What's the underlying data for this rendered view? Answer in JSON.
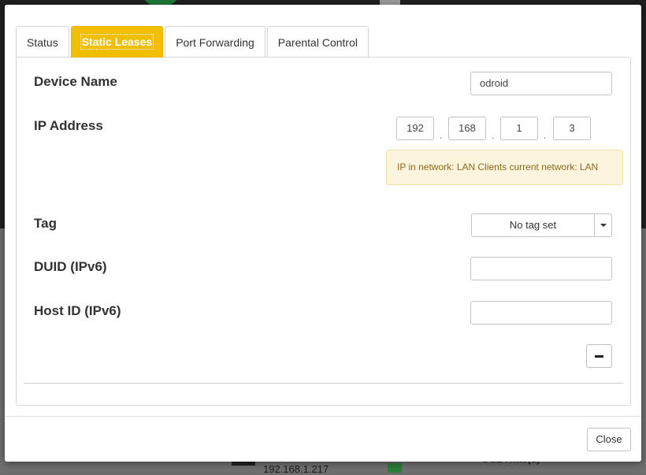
{
  "background": {
    "client_ip": "192.168.1.217",
    "dsl_label": "DSL Rate(s)"
  },
  "tabs": [
    {
      "label": "Status",
      "active": false
    },
    {
      "label": "Static Leases",
      "active": true
    },
    {
      "label": "Port Forwarding",
      "active": false
    },
    {
      "label": "Parental Control",
      "active": false
    }
  ],
  "form": {
    "device_name": {
      "label": "Device Name",
      "value": "odroid"
    },
    "ip_address": {
      "label": "IP Address",
      "octets": [
        "192",
        "168",
        "1",
        "3"
      ],
      "separator": ".",
      "info": "IP in network: LAN Clients current network: LAN"
    },
    "tag": {
      "label": "Tag",
      "value": "No tag set"
    },
    "duid": {
      "label": "DUID (IPv6)",
      "value": ""
    },
    "host_id": {
      "label": "Host ID (IPv6)",
      "value": ""
    }
  },
  "footer": {
    "close_label": "Close"
  },
  "colors": {
    "active_tab": "#f2bf00",
    "info_background": "#fdf4dd",
    "info_text": "#8a6a1f"
  }
}
